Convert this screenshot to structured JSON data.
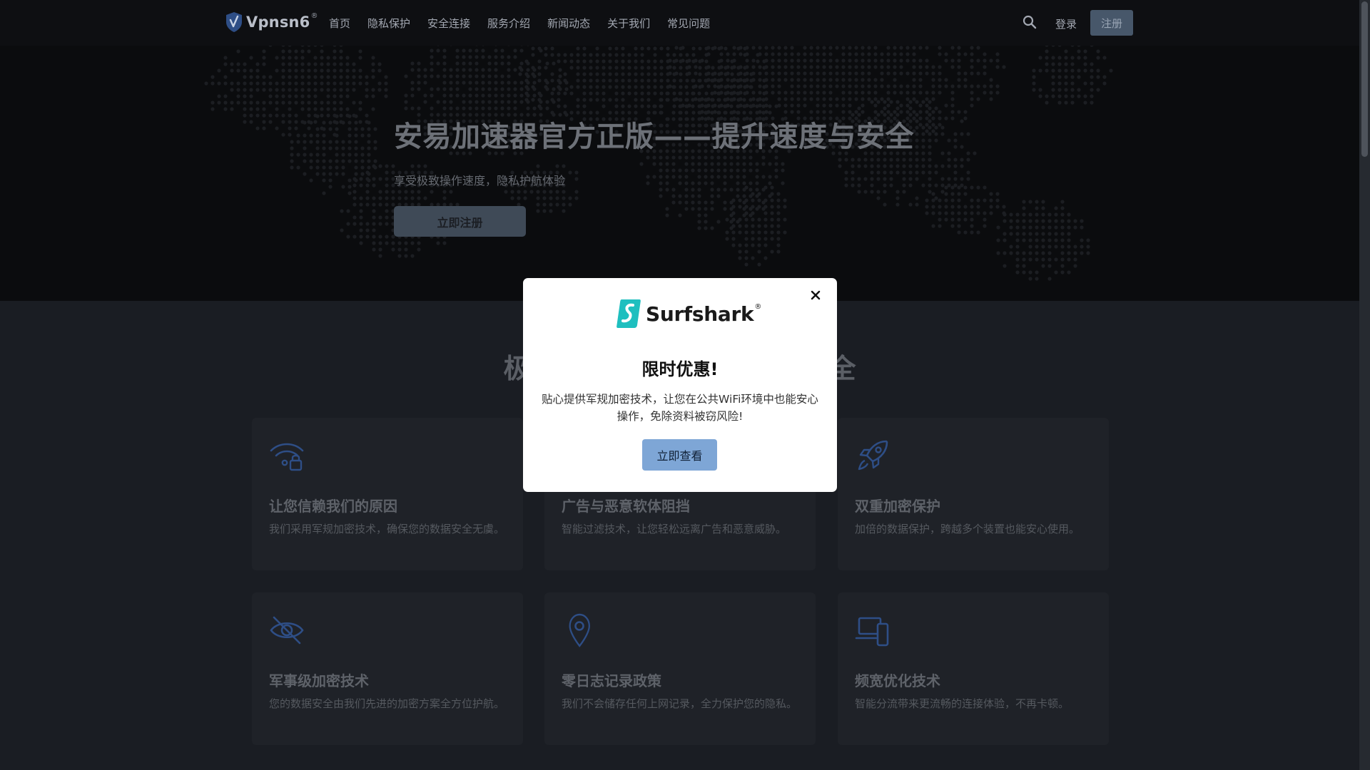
{
  "header": {
    "brand": "Vpnsn6",
    "brand_reg": "®",
    "nav": [
      "首页",
      "隐私保护",
      "安全连接",
      "服务介绍",
      "新闻动态",
      "关于我们",
      "常见问题"
    ],
    "login": "登录",
    "signup": "注册"
  },
  "hero": {
    "title": "安易加速器官方正版——提升速度与安全",
    "subtitle": "享受极致操作速度，隐私护航体验",
    "cta": "立即注册"
  },
  "features": {
    "title": "极速连接，守护您的网络安全",
    "cards": [
      {
        "icon": "wifi-lock-icon",
        "title": "让您信赖我们的原因",
        "desc": "我们采用军规加密技术，确保您的数据安全无虞。"
      },
      {
        "icon": "shield-block-icon",
        "title": "广告与恶意软体阻挡",
        "desc": "智能过滤技术，让您轻松远离广告和恶意威胁。"
      },
      {
        "icon": "rocket-icon",
        "title": "双重加密保护",
        "desc": "加倍的数据保护，跨越多个装置也能安心使用。"
      },
      {
        "icon": "eye-off-icon",
        "title": "军事级加密技术",
        "desc": "您的数据安全由我们先进的加密方案全方位护航。"
      },
      {
        "icon": "location-pin-icon",
        "title": "零日志记录政策",
        "desc": "我们不会储存任何上网记录，全力保护您的隐私。"
      },
      {
        "icon": "devices-icon",
        "title": "频宽优化技术",
        "desc": "智能分流带来更流畅的连接体验，不再卡顿。"
      }
    ]
  },
  "modal": {
    "brand": "Surfshark",
    "brand_reg": "®",
    "title": "限时优惠!",
    "text": "贴心提供军规加密技术，让您在公共WiFi环境中也能安心操作，免除资料被窃风险!",
    "button": "立即查看"
  },
  "colors": {
    "accent": "#7ea6d6",
    "icon_blue": "#2e4e86",
    "surfshark_teal": "#1ebfbf"
  }
}
